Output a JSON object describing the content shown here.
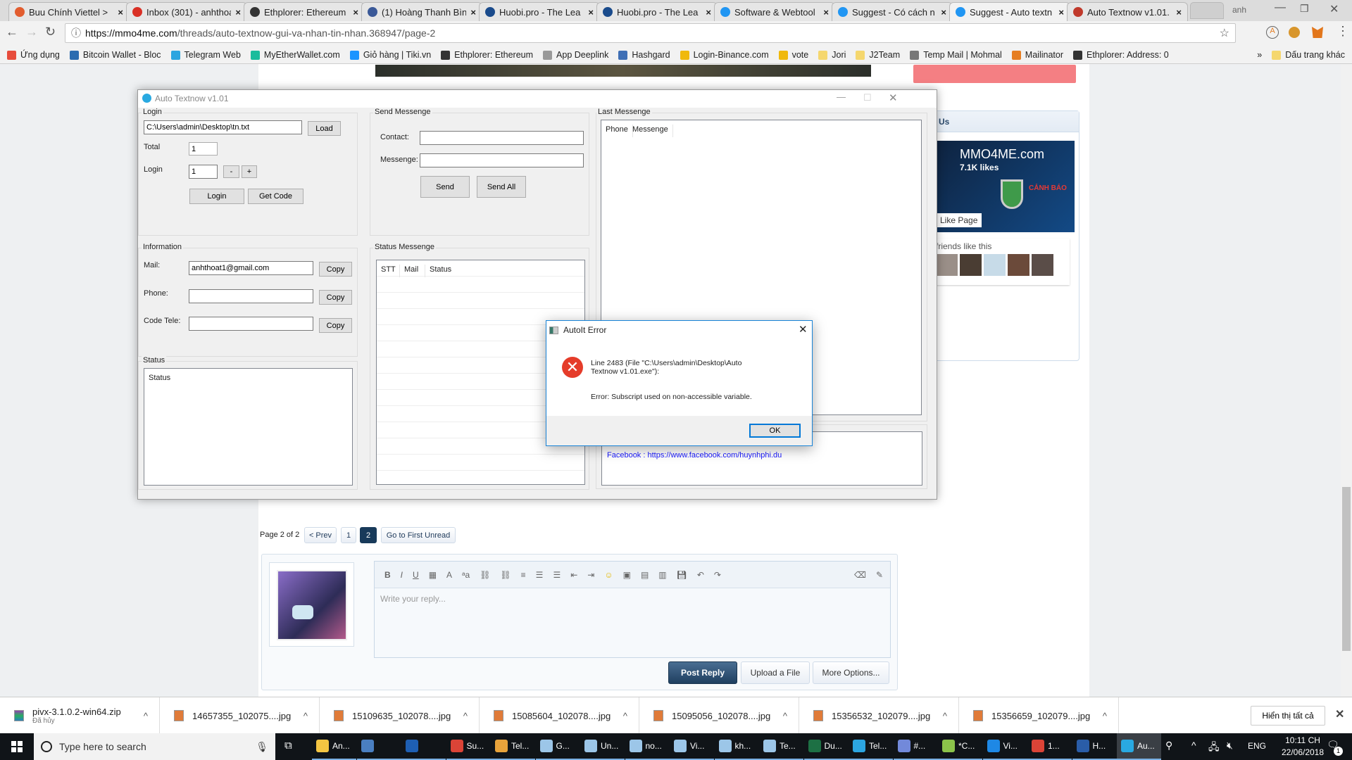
{
  "browser": {
    "tabs": [
      {
        "label": "Buu Chính Viettel > ",
        "icon": "viettel-icon",
        "color": "#e25d2f"
      },
      {
        "label": "Inbox (301) - anhthoa",
        "icon": "gmail-icon",
        "color": "#d93025"
      },
      {
        "label": "Ethplorer: Ethereum",
        "icon": "ethereum-icon",
        "color": "#333333"
      },
      {
        "label": "(1) Hoàng Thanh Bìn",
        "icon": "facebook-icon",
        "color": "#3b5998"
      },
      {
        "label": "Huobi.pro - The Lea",
        "icon": "huobi-icon",
        "color": "#1a4b8c"
      },
      {
        "label": "Huobi.pro - The Lea",
        "icon": "huobi-icon",
        "color": "#1a4b8c"
      },
      {
        "label": "Software & Webtool",
        "icon": "mmo4me-icon",
        "color": "#2196f3"
      },
      {
        "label": "Suggest - Có cách n",
        "icon": "mmo4me-icon",
        "color": "#2196f3"
      },
      {
        "label": "Suggest - Auto textn",
        "icon": "mmo4me-icon",
        "color": "#2196f3",
        "active": true
      },
      {
        "label": "Auto Textnow v1.01.",
        "icon": "cloud-icon",
        "color": "#c0392b"
      }
    ],
    "profile": "anh",
    "url_domain": "https://mmo4me.com",
    "url_path": "/threads/auto-textnow-gui-va-nhan-tin-nhan.368947/page-2",
    "bookmarks": [
      {
        "label": "Ứng dụng",
        "color": "#e74c3c"
      },
      {
        "label": "Bitcoin Wallet - Bloc",
        "color": "#2b6cb0"
      },
      {
        "label": "Telegram Web",
        "color": "#2ca5e0"
      },
      {
        "label": "MyEtherWallet.com",
        "color": "#1abc9c"
      },
      {
        "label": "Giỏ hàng | Tiki.vn",
        "color": "#1a94ff"
      },
      {
        "label": "Ethplorer: Ethereum",
        "color": "#333333"
      },
      {
        "label": "App Deeplink",
        "color": "#999999"
      },
      {
        "label": "Hashgard",
        "color": "#3f6fb5"
      },
      {
        "label": "Login-Binance.com",
        "color": "#f0b90b"
      },
      {
        "label": "vote",
        "color": "#f0b90b"
      },
      {
        "label": "Jori",
        "color": "#f5d76e"
      },
      {
        "label": "J2Team",
        "color": "#f5d76e"
      },
      {
        "label": "Temp Mail | Mohmal",
        "color": "#777777"
      },
      {
        "label": "Mailinator",
        "color": "#e67e22"
      },
      {
        "label": "Ethplorer: Address: 0",
        "color": "#333333"
      }
    ],
    "more_bookmarks": "»",
    "other_bookmarks": "Dấu trang khác"
  },
  "forum": {
    "facebook_widget": {
      "header": "Us",
      "page_name": "MMO4ME.com",
      "likes": "7.1K likes",
      "like_button": "Like Page",
      "friends_text": "friends like this",
      "banner_warning": "CẢNH BÁO"
    },
    "pagination": {
      "label": "Page 2 of 2",
      "prev": "< Prev",
      "pages": [
        "1",
        "2"
      ],
      "current": "2",
      "first_unread": "Go to First Unread"
    },
    "reply": {
      "placeholder": "Write your reply...",
      "post": "Post Reply",
      "upload": "Upload a File",
      "more": "More Options..."
    }
  },
  "app": {
    "title": "Auto Textnow v1.01",
    "login": {
      "group": "Login",
      "path": "C:\\Users\\admin\\Desktop\\tn.txt",
      "load": "Load",
      "total_label": "Total",
      "total_value": "1",
      "login_label": "Login",
      "login_value": "1",
      "minus": "-",
      "plus": "+",
      "login_button": "Login",
      "get_code": "Get Code"
    },
    "send": {
      "group": "Send Messenge",
      "contact_label": "Contact:",
      "contact_value": "",
      "message_label": "Messenge:",
      "message_value": "",
      "send": "Send",
      "send_all": "Send All"
    },
    "last": {
      "group": "Last Messenge",
      "col_phone": "Phone",
      "col_message": "Messenge"
    },
    "info": {
      "group": "Information",
      "mail_label": "Mail:",
      "mail_value": "anhthoat1@gmail.com",
      "phone_label": "Phone:",
      "phone_value": "",
      "code_label": "Code Tele:",
      "code_value": "",
      "copy": "Copy"
    },
    "status_msg": {
      "group": "Status Messenge",
      "col_stt": "STT",
      "col_mail": "Mail",
      "col_status": "Status"
    },
    "status": {
      "group": "Status",
      "text": "Status"
    },
    "facebook_link": "Facebook : https://www.facebook.com/huynhphi.du"
  },
  "dialog": {
    "title": "AutoIt Error",
    "line1": "Line 2483  (File \"C:\\Users\\admin\\Desktop\\Auto Textnow v1.01.exe\"):",
    "error": "Error: Subscript used on non-accessible variable.",
    "ok": "OK"
  },
  "downloads": {
    "items": [
      {
        "name": "pivx-3.1.0.2-win64.zip",
        "status": "Đã hủy"
      },
      {
        "name": "14657355_102075....jpg"
      },
      {
        "name": "15109635_102078....jpg"
      },
      {
        "name": "15085604_102078....jpg"
      },
      {
        "name": "15095056_102078....jpg"
      },
      {
        "name": "15356532_102079....jpg"
      },
      {
        "name": "15356659_102079....jpg"
      }
    ],
    "show_all": "Hiển thị tất cả"
  },
  "taskbar": {
    "search_placeholder": "Type here to search",
    "apps": [
      {
        "label": "An...",
        "icon": "folder-icon",
        "color": "#f4c542"
      },
      {
        "label": "",
        "icon": "network-app-icon",
        "color": "#4a7fc1"
      },
      {
        "label": "",
        "icon": "globe-icon",
        "color": "#1e5fb3"
      },
      {
        "label": "Su...",
        "icon": "chrome-icon",
        "color": "#db4437"
      },
      {
        "label": "Tel...",
        "icon": "app-icon",
        "color": "#e8a33b"
      },
      {
        "label": "G...",
        "icon": "notepad-icon",
        "color": "#9cc6e8"
      },
      {
        "label": "Un...",
        "icon": "notepad-icon",
        "color": "#9cc6e8"
      },
      {
        "label": "no...",
        "icon": "notepad-icon",
        "color": "#9cc6e8"
      },
      {
        "label": "Vi...",
        "icon": "notepad-icon",
        "color": "#9cc6e8"
      },
      {
        "label": "kh...",
        "icon": "notepad-icon",
        "color": "#9cc6e8"
      },
      {
        "label": "Te...",
        "icon": "notepad-icon",
        "color": "#9cc6e8"
      },
      {
        "label": "Du...",
        "icon": "excel-icon",
        "color": "#1d7044"
      },
      {
        "label": "Tel...",
        "icon": "telegram-icon",
        "color": "#2ca5e0"
      },
      {
        "label": "#...",
        "icon": "discord-icon",
        "color": "#7289da"
      },
      {
        "label": "*C...",
        "icon": "notepadpp-icon",
        "color": "#8bc34a"
      },
      {
        "label": "Vi...",
        "icon": "3g-icon",
        "color": "#1e88e5"
      },
      {
        "label": "1...",
        "icon": "chrome-icon",
        "color": "#db4437"
      },
      {
        "label": "H...",
        "icon": "thunderbird-icon",
        "color": "#2a5da8"
      },
      {
        "label": "Au...",
        "icon": "autotextnow-icon",
        "color": "#29a9e1",
        "active": true
      }
    ],
    "language": "ENG",
    "time": "10:11 CH",
    "date": "22/06/2018",
    "notifications": "1"
  }
}
